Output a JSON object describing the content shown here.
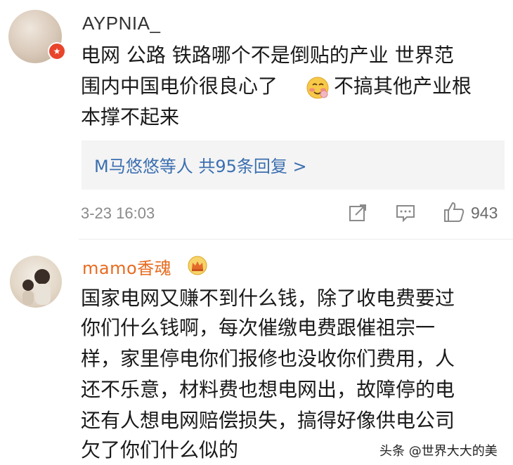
{
  "comments": [
    {
      "username": "AYPNIA_",
      "lines": [
        "电网 公路 铁路哪个不是倒贴的产业 世界范",
        "围内中国电价很良心了",
        "不搞其他产业根",
        "本撑不起来"
      ],
      "emoji": "blush-emoji",
      "badge": "verified-badge",
      "reply_summary": "M马悠悠等人 共95条回复 >",
      "timestamp": "3-23 16:03",
      "like_count": "943"
    },
    {
      "username": "mamo香魂",
      "badge": "crown-badge",
      "lines": [
        "国家电网又赚不到什么钱，除了收电费要过",
        "你们什么钱啊，每次催缴电费跟催祖宗一",
        "样，家里停电你们报修也没收你们费用，人",
        "还不乐意，材料费也想电网出，故障停的电",
        "还有人想电网赔偿损失，搞得好像供电公司",
        "欠了你们什么似的"
      ]
    }
  ],
  "watermark": "头条 @世界大大的美",
  "colors": {
    "reply_link": "#3b6fb0",
    "vip_name": "#e86b1f",
    "reply_bg": "#f4f4f4",
    "meta_gray": "#8a8a8a"
  }
}
